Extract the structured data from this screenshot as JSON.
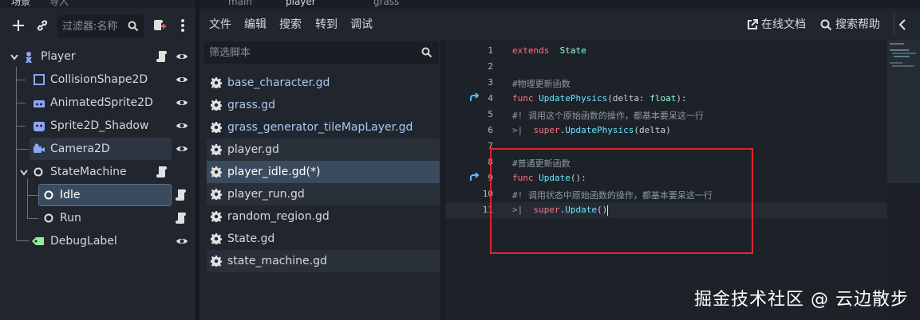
{
  "scene_dock": {
    "tabs": [
      "场景",
      "导入"
    ],
    "filter_placeholder": "过滤器:名称",
    "tree": [
      {
        "label": "Player",
        "icon": "character-body-icon",
        "depth": 0,
        "script": true,
        "eye": true,
        "selected": false
      },
      {
        "label": "CollisionShape2D",
        "icon": "collision-shape-icon",
        "depth": 1,
        "script": false,
        "eye": true,
        "selected": false
      },
      {
        "label": "AnimatedSprite2D",
        "icon": "animated-sprite-icon",
        "depth": 1,
        "script": false,
        "eye": true,
        "selected": false
      },
      {
        "label": "Sprite2D_Shadow",
        "icon": "sprite-icon",
        "depth": 1,
        "script": false,
        "eye": true,
        "selected": false
      },
      {
        "label": "Camera2D",
        "icon": "camera-icon",
        "depth": 1,
        "script": false,
        "eye": true,
        "selected": false
      },
      {
        "label": "StateMachine",
        "icon": "node-icon",
        "depth": 1,
        "script": true,
        "eye": false,
        "selected": false
      },
      {
        "label": "Idle",
        "icon": "node-icon",
        "depth": 2,
        "script": true,
        "eye": false,
        "selected": true
      },
      {
        "label": "Run",
        "icon": "node-icon",
        "depth": 2,
        "script": true,
        "eye": false,
        "selected": false
      },
      {
        "label": "DebugLabel",
        "icon": "label-icon",
        "depth": 1,
        "script": false,
        "eye": true,
        "selected": false
      }
    ]
  },
  "editor_tabs": [
    "main",
    "player",
    "grass"
  ],
  "menu": {
    "items": [
      "文件",
      "编辑",
      "搜索",
      "转到",
      "调试"
    ],
    "online_docs": "在线文档",
    "search_help": "搜索帮助"
  },
  "script_list": {
    "filter_placeholder": "筛选脚本",
    "items": [
      {
        "name": "base_character.gd",
        "active": false
      },
      {
        "name": "grass.gd",
        "active": false
      },
      {
        "name": "grass_generator_tileMapLayer.gd",
        "active": false
      },
      {
        "name": "player.gd",
        "active": false
      },
      {
        "name": "player_idle.gd(*)",
        "active": true
      },
      {
        "name": "player_run.gd",
        "active": false
      },
      {
        "name": "random_region.gd",
        "active": false
      },
      {
        "name": "State.gd",
        "active": false
      },
      {
        "name": "state_machine.gd",
        "active": false
      }
    ]
  },
  "code": {
    "lines": [
      {
        "n": "1",
        "parts": [
          [
            "kw",
            "extends"
          ],
          [
            "",
            "  "
          ],
          [
            "tp",
            "State"
          ]
        ]
      },
      {
        "n": "2",
        "parts": []
      },
      {
        "n": "3",
        "parts": [
          [
            "cm",
            "#物理更新函数"
          ]
        ]
      },
      {
        "n": "4",
        "override": true,
        "parts": [
          [
            "kw",
            "func "
          ],
          [
            "fn",
            "UpdatePhysics"
          ],
          [
            "",
            "(delta: "
          ],
          [
            "tp",
            "float"
          ],
          [
            "",
            "):"
          ]
        ]
      },
      {
        "n": "5",
        "parts": [
          [
            "cm",
            "#! 调用这个原始函数的操作，都基本要呆这一行"
          ]
        ]
      },
      {
        "n": "6",
        "parts": [
          [
            "cm",
            ">|  "
          ],
          [
            "kw",
            "super"
          ],
          [
            "",
            "."
          ],
          [
            "fn",
            "UpdatePhysics"
          ],
          [
            "",
            "(delta)"
          ]
        ]
      },
      {
        "n": "7",
        "parts": []
      },
      {
        "n": "8",
        "parts": [
          [
            "cm",
            "#普通更新函数"
          ]
        ]
      },
      {
        "n": "9",
        "override": true,
        "parts": [
          [
            "kw",
            "func "
          ],
          [
            "fn",
            "Update"
          ],
          [
            "",
            "():"
          ]
        ]
      },
      {
        "n": "10",
        "parts": [
          [
            "cm",
            "#! 调用状态中原始函数的操作，都基本要呆这一行"
          ]
        ]
      },
      {
        "n": "11",
        "current": true,
        "parts": [
          [
            "cm",
            ">|  "
          ],
          [
            "kw",
            "super"
          ],
          [
            "",
            "."
          ],
          [
            "fn",
            "Update"
          ],
          [
            "",
            "()"
          ]
        ]
      }
    ]
  },
  "watermark": "掘金技术社区 @ 云边散步",
  "colors": {
    "selected_row": "#3b4b5e",
    "highlight_row": "#2d3542",
    "annotation_box": "#e0252d"
  }
}
